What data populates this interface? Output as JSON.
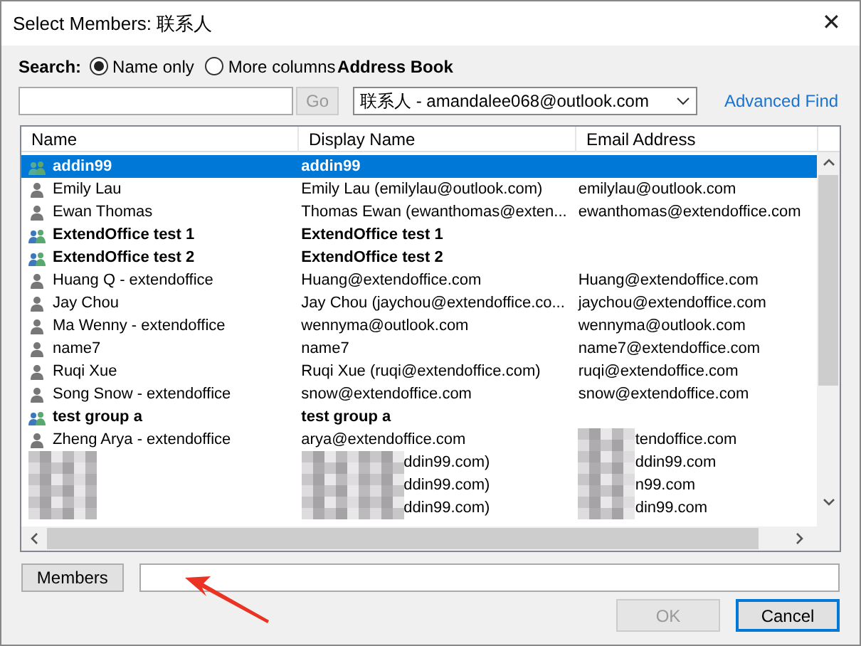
{
  "window": {
    "title": "Select Members: 联系人",
    "close": "✕"
  },
  "search": {
    "label": "Search:",
    "options": [
      {
        "label": "Name only",
        "selected": true
      },
      {
        "label": "More columns",
        "selected": false
      }
    ],
    "go": "Go",
    "go_disabled": true
  },
  "address_book": {
    "label": "Address Book",
    "value": "联系人 - amandalee068@outlook.com",
    "advanced_find": "Advanced Find"
  },
  "table": {
    "columns": [
      "Name",
      "Display Name",
      "Email Address"
    ],
    "rows": [
      {
        "kind": "group",
        "name": "addin99",
        "display_name": "addin99",
        "selected": true,
        "masked": false,
        "email_masked": false
      },
      {
        "kind": "person",
        "name": "Emily Lau",
        "display_name": "Emily Lau (emilylau@outlook.com)",
        "email": "emilylau@outlook.com",
        "selected": false,
        "masked": false,
        "email_masked": false
      },
      {
        "kind": "person",
        "name": "Ewan Thomas",
        "display_name": "Thomas Ewan (ewanthomas@exten...",
        "email": "ewanthomas@extendoffice.com",
        "selected": false,
        "masked": false,
        "email_masked": false
      },
      {
        "kind": "group",
        "name": "ExtendOffice test 1",
        "display_name": "ExtendOffice test 1",
        "selected": false,
        "masked": false,
        "email_masked": false
      },
      {
        "kind": "group",
        "name": "ExtendOffice test 2",
        "display_name": "ExtendOffice test 2",
        "selected": false,
        "masked": false,
        "email_masked": false
      },
      {
        "kind": "person",
        "name": "Huang Q - extendoffice",
        "display_name": "Huang@extendoffice.com",
        "email": "Huang@extendoffice.com",
        "selected": false,
        "masked": false,
        "email_masked": false
      },
      {
        "kind": "person",
        "name": "Jay Chou",
        "display_name": "Jay Chou (jaychou@extendoffice.co...",
        "email": "jaychou@extendoffice.com",
        "selected": false,
        "masked": false,
        "email_masked": false
      },
      {
        "kind": "person",
        "name": "Ma Wenny - extendoffice",
        "display_name": "wennyma@outlook.com",
        "email": "wennyma@outlook.com",
        "selected": false,
        "masked": false,
        "email_masked": false
      },
      {
        "kind": "person",
        "name": "name7",
        "display_name": "name7",
        "email": "name7@extendoffice.com",
        "selected": false,
        "masked": false,
        "email_masked": false
      },
      {
        "kind": "person",
        "name": "Ruqi Xue",
        "display_name": "Ruqi Xue (ruqi@extendoffice.com)",
        "email": "ruqi@extendoffice.com",
        "selected": false,
        "masked": false,
        "email_masked": false
      },
      {
        "kind": "person",
        "name": "Song Snow - extendoffice",
        "display_name": "snow@extendoffice.com",
        "email": "snow@extendoffice.com",
        "selected": false,
        "masked": false,
        "email_masked": false
      },
      {
        "kind": "group",
        "name": "test group a",
        "display_name": "test group a",
        "selected": false,
        "masked": false,
        "email_masked": false
      },
      {
        "kind": "person",
        "name": "Zheng Arya - extendoffice",
        "display_name": "arya@extendoffice.com",
        "email": "tendoffice.com",
        "selected": false,
        "masked": false,
        "email_masked": true
      },
      {
        "kind": "hidden",
        "display_name": "ddin99.com)",
        "email": "ddin99.com",
        "selected": false,
        "masked": true,
        "email_masked": true
      },
      {
        "kind": "hidden",
        "display_name": "ddin99.com)",
        "email": "n99.com",
        "selected": false,
        "masked": true,
        "email_masked": true
      },
      {
        "kind": "hidden",
        "display_name": "ddin99.com)",
        "email": "din99.com",
        "selected": false,
        "masked": true,
        "email_masked": true
      }
    ]
  },
  "members": {
    "button": "Members"
  },
  "buttons": [
    {
      "label": "OK",
      "disabled": true
    },
    {
      "label": "Cancel",
      "disabled": false
    }
  ]
}
